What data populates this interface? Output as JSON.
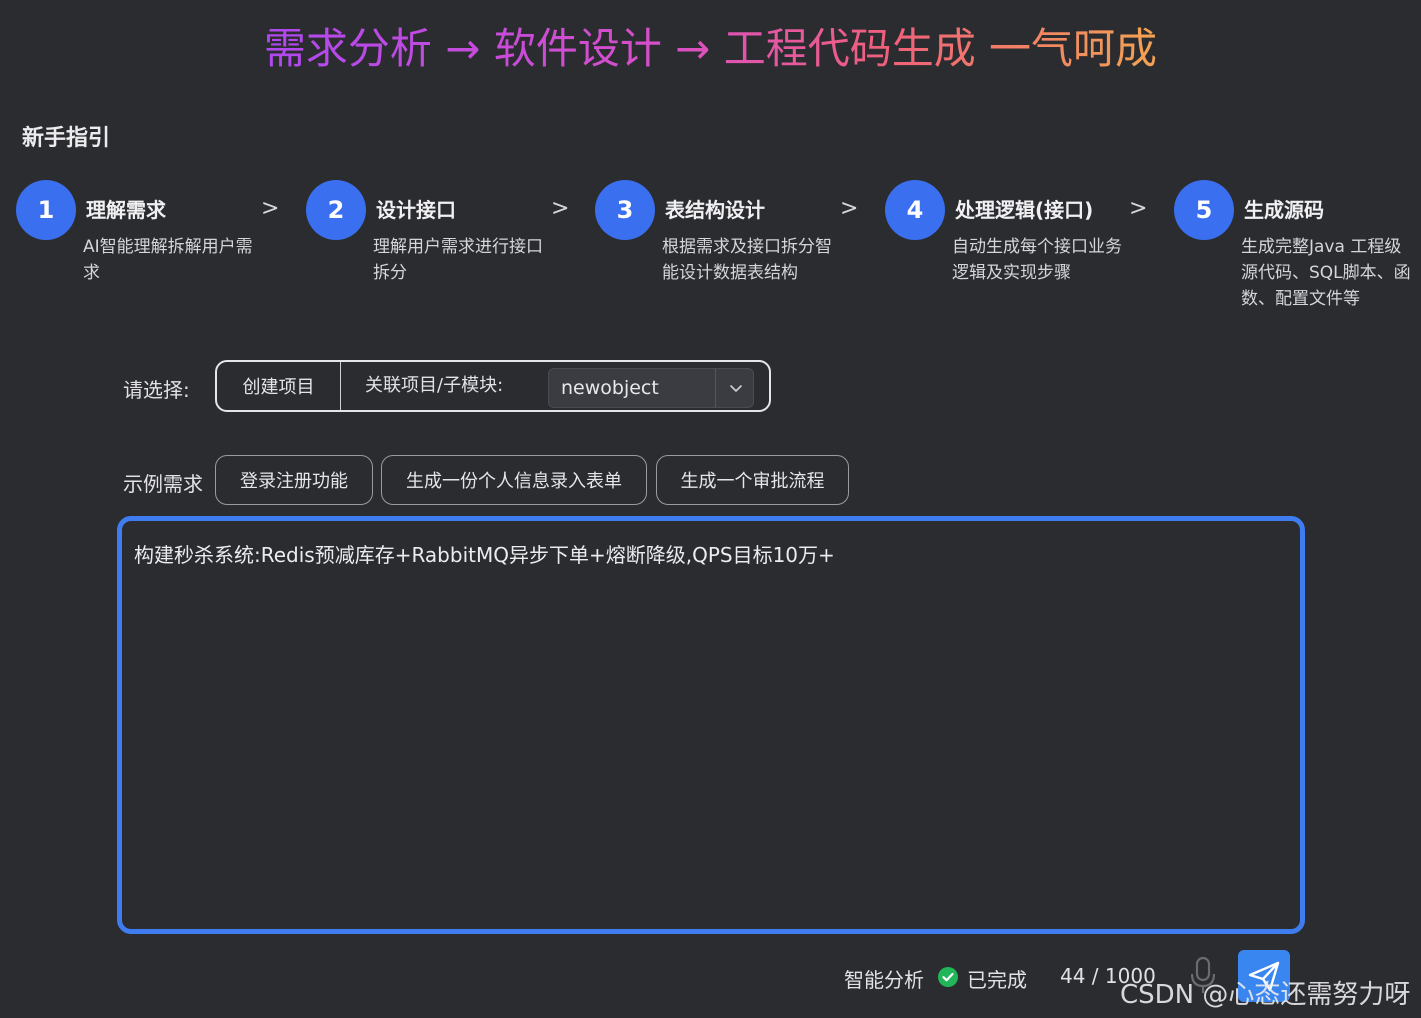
{
  "hero": {
    "title": "需求分析 → 软件设计 → 工程代码生成 一气呵成"
  },
  "guide": {
    "title": "新手指引",
    "arrow": ">",
    "steps": [
      {
        "num": "1",
        "title": "理解需求",
        "desc": "AI智能理解拆解用户需求"
      },
      {
        "num": "2",
        "title": "设计接口",
        "desc": "理解用户需求进行接口拆分"
      },
      {
        "num": "3",
        "title": "表结构设计",
        "desc": "根据需求及接口拆分智能设计数据表结构"
      },
      {
        "num": "4",
        "title": "处理逻辑(接口)",
        "desc": "自动生成每个接口业务逻辑及实现步骤"
      },
      {
        "num": "5",
        "title": "生成源码",
        "desc": "生成完整Java 工程级源代码、SQL脚本、函数、配置文件等"
      }
    ]
  },
  "selector": {
    "label": "请选择:",
    "create_label": "创建项目",
    "link_label": "关联项目/子模块:",
    "project_value": "newobject"
  },
  "examples": {
    "label": "示例需求",
    "items": [
      "登录注册功能",
      "生成一份个人信息录入表单",
      "生成一个审批流程"
    ]
  },
  "input": {
    "value": "构建秒杀系统:Redis预减库存+RabbitMQ异步下单+熔断降级,QPS目标10万+"
  },
  "footer": {
    "analysis_label": "智能分析",
    "status_label": "已完成",
    "counter": "44 / 1000",
    "watermark": "CSDN @心态还需努力呀"
  },
  "colors": {
    "accent": "#3f7cf0",
    "step_circle": "#3a6ff0",
    "success": "#22b65a",
    "background": "#2b2c30"
  },
  "icons": {
    "check": "check-circle-icon",
    "mic": "microphone-icon",
    "send": "paper-plane-icon",
    "chevron": "chevron-down-icon"
  }
}
